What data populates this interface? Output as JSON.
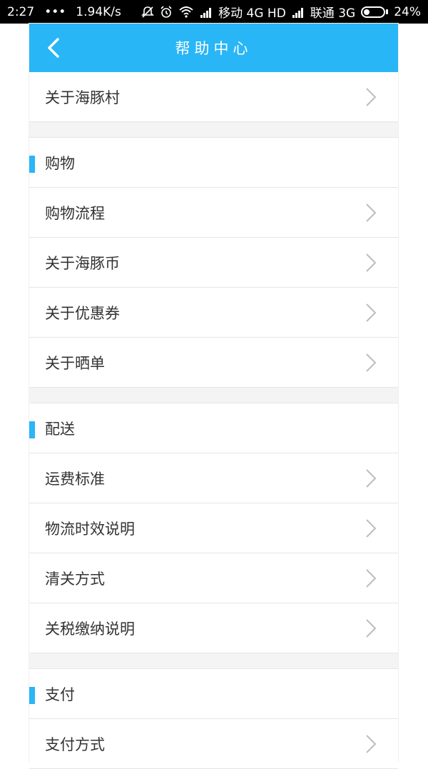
{
  "status_bar": {
    "time": "2:27",
    "dots": "•••",
    "speed": "1.94K/s",
    "carrier1": "移动 4G HD",
    "carrier2": "联通 3G",
    "battery": "24%"
  },
  "header": {
    "title": "帮助中心"
  },
  "top_item": {
    "label": "关于海豚村"
  },
  "sections": [
    {
      "title": "购物",
      "items": [
        "购物流程",
        "关于海豚币",
        "关于优惠券",
        "关于晒单"
      ]
    },
    {
      "title": "配送",
      "items": [
        "运费标准",
        "物流时效说明",
        "清关方式",
        "关税缴纳说明"
      ]
    },
    {
      "title": "支付",
      "items": [
        "支付方式"
      ]
    }
  ],
  "colors": {
    "accent": "#29b6f6",
    "divider_bg": "#f4f4f4",
    "text": "#333333"
  }
}
